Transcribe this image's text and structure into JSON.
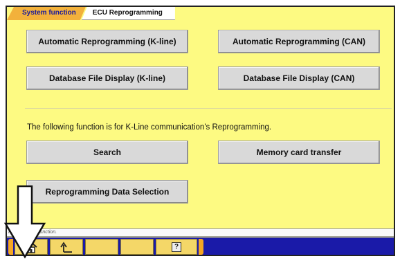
{
  "breadcrumb": {
    "items": [
      "System function",
      "ECU Reprogramming"
    ]
  },
  "buttons": {
    "auto_kline": "Automatic Reprogramming (K-line)",
    "auto_can": "Automatic Reprogramming (CAN)",
    "db_kline": "Database File Display (K-line)",
    "db_can": "Database File Display (CAN)",
    "search": "Search",
    "memory_card": "Memory card transfer",
    "data_selection": "Reprogramming Data Selection"
  },
  "note": "The following function is for K-Line communication's Reprogramming.",
  "status_bar": {
    "text": "Please select function."
  },
  "taskbar": {
    "icons": [
      "home-icon",
      "back-up-icon",
      "blank",
      "blank",
      "help-icon"
    ],
    "help_label": "?"
  },
  "colors": {
    "panel_bg": "#fdfa82",
    "breadcrumb_active": "#f2b13b",
    "taskbar_bg": "#1a1aa8",
    "button_bg": "#d9d9d9"
  }
}
